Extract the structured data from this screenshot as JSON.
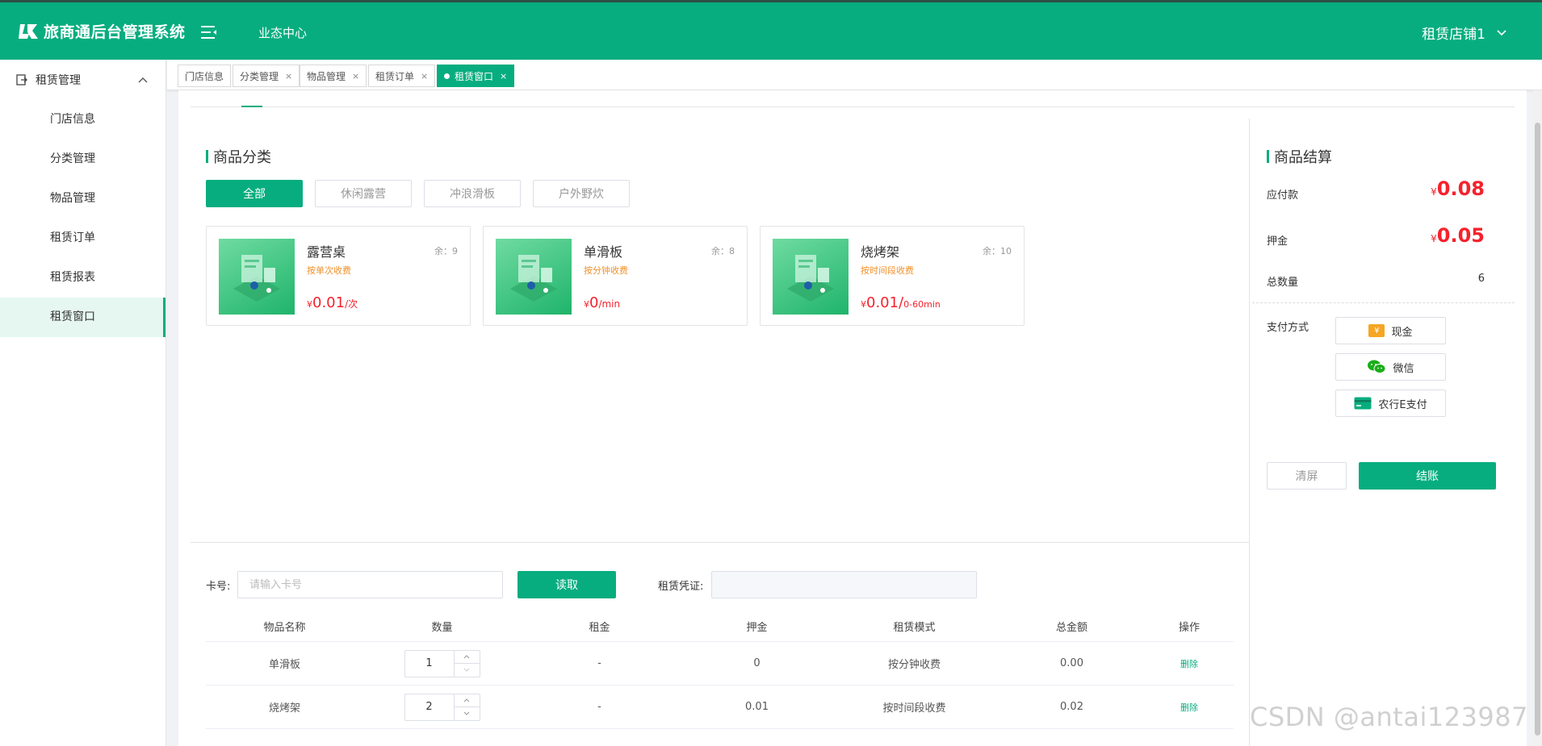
{
  "app": {
    "title": "旅商通后台管理系统"
  },
  "header": {
    "nav_item": "业态中心",
    "user": "租赁店铺1"
  },
  "sidebar": {
    "group": "租赁管理",
    "items": [
      {
        "label": "门店信息"
      },
      {
        "label": "分类管理"
      },
      {
        "label": "物品管理"
      },
      {
        "label": "租赁订单"
      },
      {
        "label": "租赁报表"
      },
      {
        "label": "租赁窗口"
      }
    ]
  },
  "tabs": [
    {
      "label": "门店信息"
    },
    {
      "label": "分类管理",
      "close": "×"
    },
    {
      "label": "物品管理",
      "close": "×"
    },
    {
      "label": "租赁订单",
      "close": "×"
    },
    {
      "label": "租赁窗口",
      "close": "×"
    }
  ],
  "catalog": {
    "title": "商品分类",
    "categories": [
      {
        "label": "全部"
      },
      {
        "label": "休闲露营"
      },
      {
        "label": "冲浪滑板"
      },
      {
        "label": "户外野炊"
      }
    ],
    "products": [
      {
        "name": "露营桌",
        "stock": "余：9",
        "mode": "按单次收费",
        "currency": "¥",
        "price": "0.01",
        "unit": "/次"
      },
      {
        "name": "单滑板",
        "stock": "余：8",
        "mode": "按分钟收费",
        "currency": "¥",
        "price": "0",
        "unit": "/min"
      },
      {
        "name": "烧烤架",
        "stock": "余：10",
        "mode": "按时间段收费",
        "currency": "¥",
        "price": "0.01/",
        "unit": "0-60min"
      }
    ]
  },
  "checkout": {
    "title": "商品结算",
    "payable_label": "应付款",
    "currency": "¥",
    "payable_value": "0.08",
    "deposit_label": "押金",
    "deposit_value": "0.05",
    "quantity_label": "总数量",
    "quantity_value": "6",
    "payment_label": "支付方式",
    "payment_methods": [
      {
        "label": "现金",
        "icon": "cash-icon",
        "glyph": "¥"
      },
      {
        "label": "微信",
        "icon": "wechat-icon"
      },
      {
        "label": "农行E支付",
        "icon": "bank-card-icon"
      }
    ],
    "clear_label": "清屏",
    "checkout_label": "结账"
  },
  "card_form": {
    "card_label": "卡号:",
    "card_placeholder": "请输入卡号",
    "card_value": "",
    "read_label": "读取",
    "voucher_label": "租赁凭证:",
    "voucher_value": ""
  },
  "table": {
    "headers": [
      "物品名称",
      "数量",
      "租金",
      "押金",
      "租赁模式",
      "总金额",
      "操作"
    ],
    "rows": [
      {
        "name": "单滑板",
        "qty": "1",
        "rent": "-",
        "deposit": "0",
        "mode": "按分钟收费",
        "total": "0.00",
        "action": "删除"
      },
      {
        "name": "烧烤架",
        "qty": "2",
        "rent": "-",
        "deposit": "0.01",
        "mode": "按时间段收费",
        "total": "0.02",
        "action": "删除"
      }
    ]
  },
  "watermark": "CSDN @antai123987",
  "colors": {
    "brand": "#07ad7f",
    "price": "#f5222d",
    "mode": "#f0902b"
  }
}
